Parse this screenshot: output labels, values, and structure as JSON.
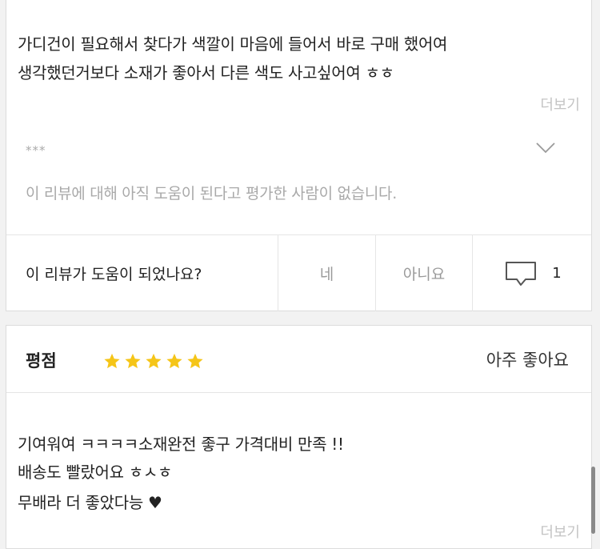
{
  "review1": {
    "lines": [
      "가디건이 필요해서 찾다가 색깔이 마음에 들어서 바로 구매 했어여",
      "생각했던거보다 소재가 좋아서 다른 색도 사고싶어여 ㅎㅎ"
    ],
    "more_label": "더보기",
    "reviewer_masked": "***",
    "helpful_note": "이 리뷰에 대해 아직 도움이 된다고 평가한 사람이 없습니다.",
    "vote": {
      "question": "이 리뷰가 도움이 되었나요?",
      "yes_label": "네",
      "no_label": "아니요",
      "comment_count": "1"
    }
  },
  "review2": {
    "rating_label": "평점",
    "stars": 5,
    "rating_text": "아주 좋아요",
    "lines": [
      "기여워여 ㅋㅋㅋㅋ소재완전 좋구 가격대비 만족 !!",
      "배송도 빨랐어요 ㅎㅅㅎ",
      "무배라 더 좋았다능 ♥"
    ],
    "more_label": "더보기"
  },
  "colors": {
    "star": "#f5c518",
    "muted": "#c4c4c4"
  }
}
